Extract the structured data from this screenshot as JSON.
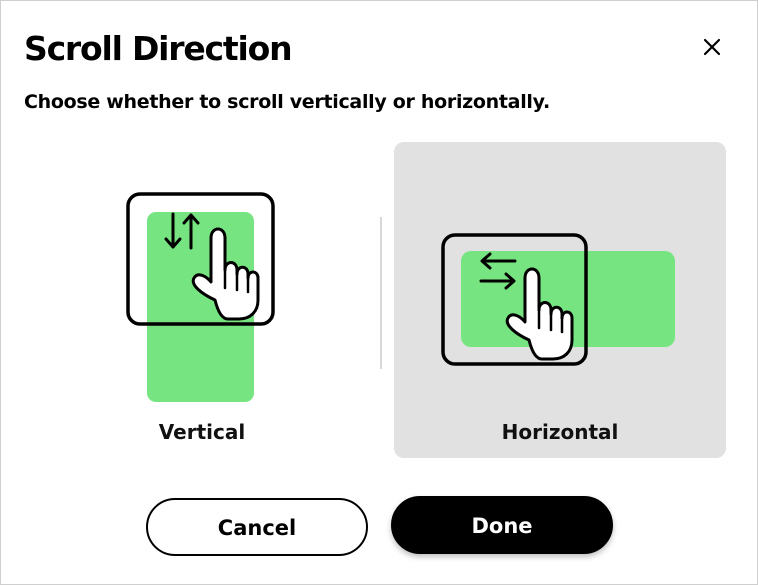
{
  "dialog": {
    "title": "Scroll Direction",
    "description": "Choose whether to scroll vertically or horizontally."
  },
  "options": [
    {
      "label": "Vertical",
      "selected": false,
      "icon": "scroll-vertical-icon"
    },
    {
      "label": "Horizontal",
      "selected": true,
      "icon": "scroll-horizontal-icon"
    }
  ],
  "actions": {
    "cancel_label": "Cancel",
    "done_label": "Done"
  },
  "colors": {
    "accent_green": "#76e581",
    "selected_bg": "#e1e1e1",
    "primary_button": "#000000"
  }
}
